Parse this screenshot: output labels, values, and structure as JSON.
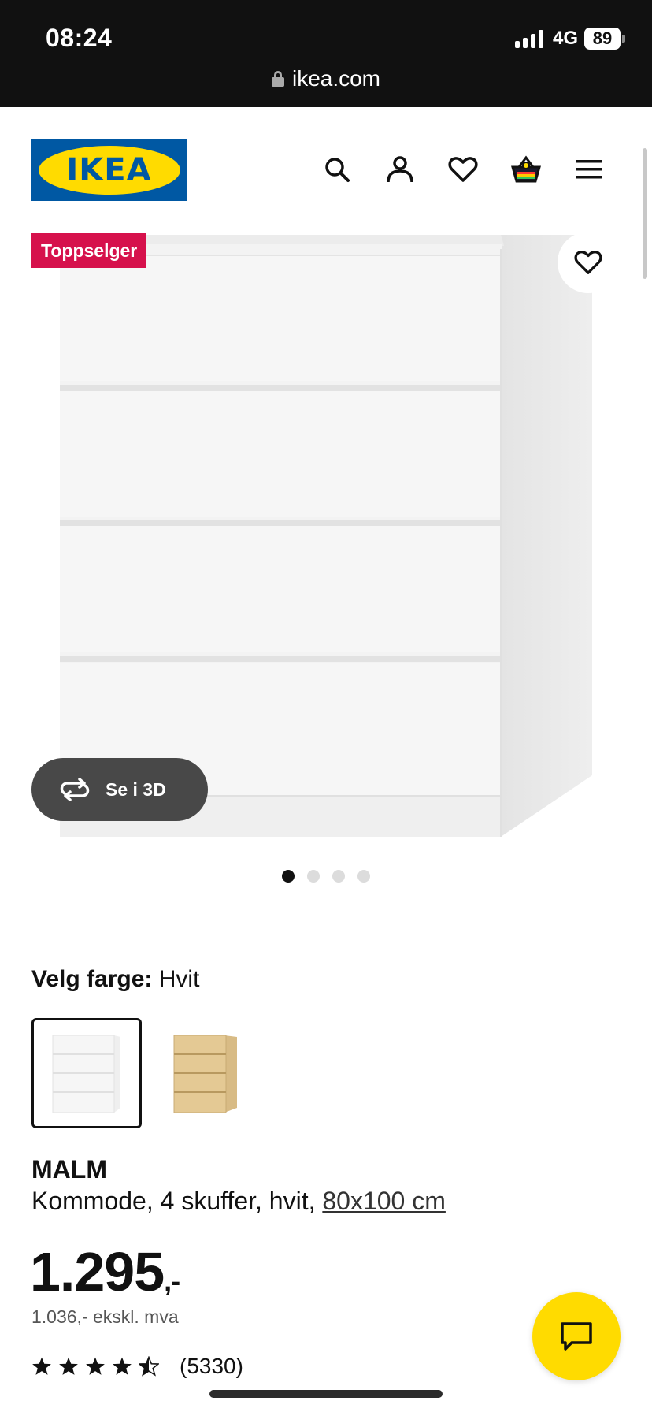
{
  "status_bar": {
    "time": "08:24",
    "network": "4G",
    "battery": "89",
    "url": "ikea.com"
  },
  "header": {
    "logo_text": "IKEA",
    "logo_colors": {
      "blue": "#0058a3",
      "yellow": "#ffdb00"
    },
    "icons": [
      "search-icon",
      "account-icon",
      "heart-icon",
      "shopping-bag-icon",
      "menu-icon"
    ]
  },
  "product_media": {
    "badge": "Toppselger",
    "badge_color": "#d6114c",
    "view_3d_label": "Se i 3D",
    "image_count": 4,
    "active_image": 1
  },
  "color_selector": {
    "label": "Velg farge:",
    "selected_value": "Hvit",
    "options": [
      {
        "name": "white-variant",
        "color": "#f2f2f2",
        "selected": true
      },
      {
        "name": "oak-variant",
        "color": "#e2c690",
        "selected": false
      }
    ]
  },
  "product": {
    "name": "MALM",
    "description": "Kommode, 4 skuffer, hvit, ",
    "size": "80x100 cm",
    "price": "1.295",
    "price_suffix": ",-",
    "price_ex_vat": "1.036,- ekskl. mva",
    "rating_stars": 4.5,
    "rating_count": "(5330)"
  },
  "chat": {
    "icon": "chat-icon",
    "color": "#ffdb00"
  }
}
